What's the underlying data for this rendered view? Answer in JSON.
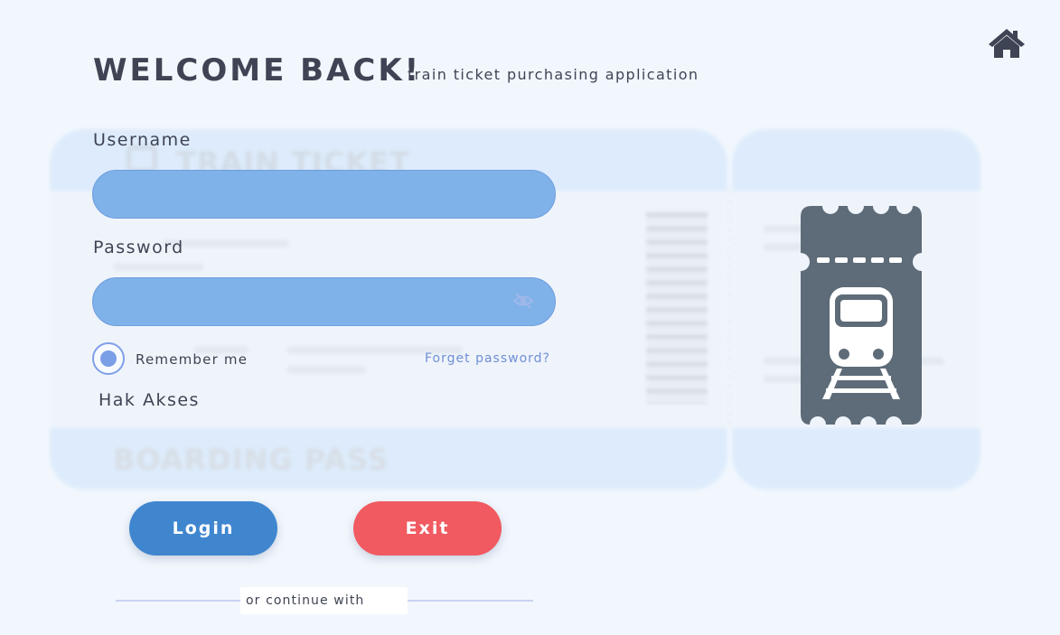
{
  "header": {
    "title": "WELCOME BACK!",
    "subtitle": "train ticket purchasing application",
    "home_icon": "home-icon"
  },
  "form": {
    "username_label": "Username",
    "username_value": "",
    "password_label": "Password",
    "password_value": "",
    "password_toggle_icon": "eye-slash-icon",
    "remember_label": "Remember me",
    "remember_checked": true,
    "forget_label": "Forget password?",
    "access_label": "Hak Akses"
  },
  "buttons": {
    "login_label": "Login",
    "exit_label": "Exit"
  },
  "divider": {
    "text": "or continue with"
  },
  "background": {
    "ticket_title": "TRAIN TICKET",
    "boarding_title": "BOARDING PASS"
  },
  "colors": {
    "input_fill": "#7fb2e9",
    "login": "#3f86cf",
    "exit": "#f05a60",
    "ticket_icon": "#5e6b78",
    "text": "#3f4454"
  }
}
